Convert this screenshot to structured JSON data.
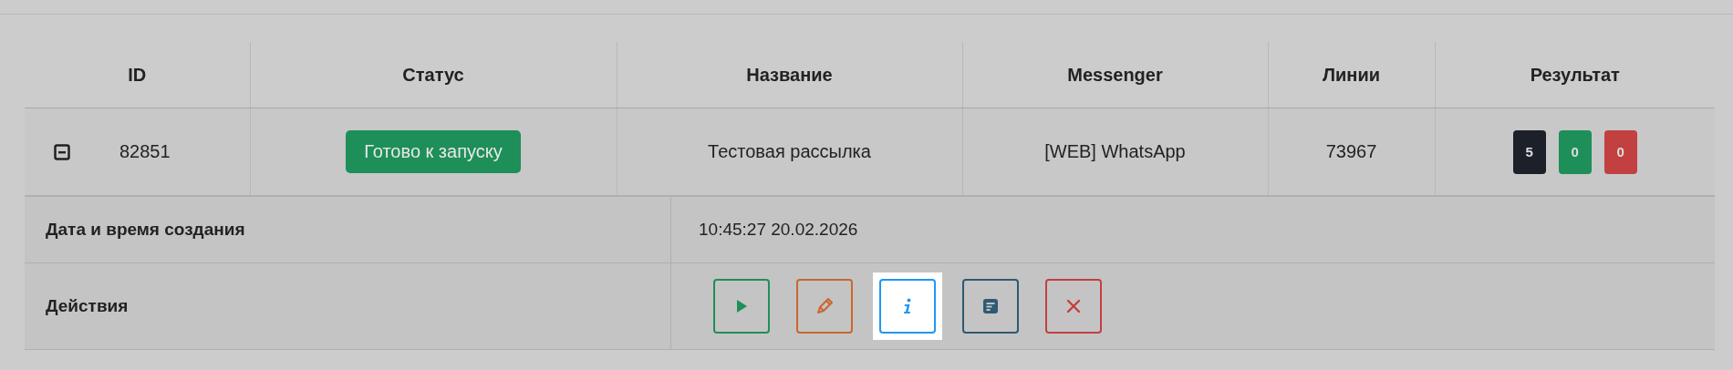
{
  "table": {
    "columns": [
      "ID",
      "Статус",
      "Название",
      "Messenger",
      "Линии",
      "Результат"
    ],
    "rows": [
      {
        "expanded": true,
        "id": "82851",
        "status": "Готово к запуску",
        "name": "Тестовая рассылка",
        "messenger": "[WEB] WhatsApp",
        "lines": "73967",
        "results": [
          {
            "value": "5",
            "color": "#1c2028"
          },
          {
            "value": "0",
            "color": "#1e8f58"
          },
          {
            "value": "0",
            "color": "#c2403f"
          }
        ],
        "details": [
          {
            "kind": "text",
            "label": "Дата и время создания",
            "value": "10:45:27 20.02.2026"
          },
          {
            "kind": "actions",
            "label": "Действия",
            "actions": [
              {
                "kind": "start",
                "highlighted": false
              },
              {
                "kind": "edit",
                "highlighted": false
              },
              {
                "kind": "info",
                "highlighted": true
              },
              {
                "kind": "log",
                "highlighted": false
              },
              {
                "kind": "delete",
                "highlighted": false
              }
            ]
          }
        ]
      }
    ]
  }
}
